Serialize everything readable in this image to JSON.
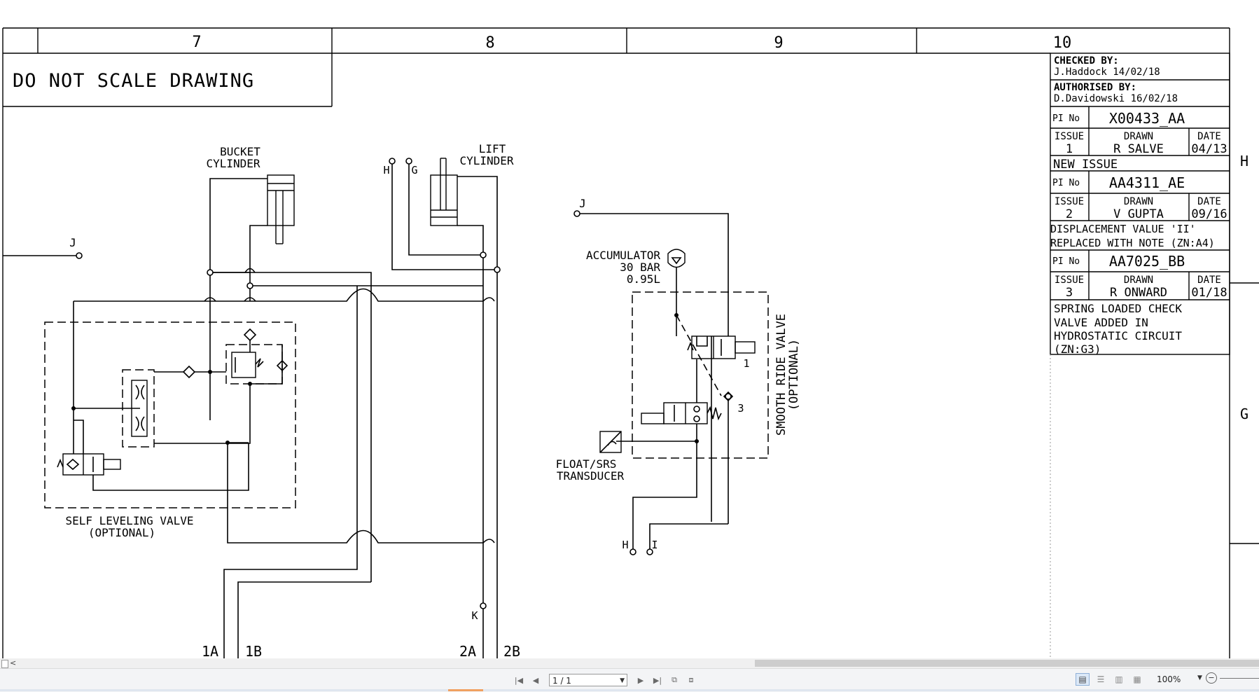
{
  "grid": {
    "columns": [
      "7",
      "8",
      "9",
      "10"
    ],
    "rows": [
      "H",
      "G"
    ]
  },
  "note": "DO NOT SCALE DRAWING",
  "title_block": {
    "checked_label": "CHECKED BY:",
    "checked_value": "J.Haddock 14/02/18",
    "authorised_label": "AUTHORISED BY:",
    "authorised_value": "D.Davidowski 16/02/18",
    "pi_label": "PI No",
    "issue_label": "ISSUE",
    "drawn_label": "DRAWN",
    "date_label": "DATE",
    "revisions": [
      {
        "pi": "X00433_AA",
        "issue": "1",
        "drawn": "R SALVE",
        "date": "04/13",
        "note": [
          "NEW ISSUE"
        ]
      },
      {
        "pi": "AA4311_AE",
        "issue": "2",
        "drawn": "V GUPTA",
        "date": "09/16",
        "note": [
          "DISPLACEMENT VALUE 'II'",
          "REPLACED WITH NOTE (ZN:A4)"
        ]
      },
      {
        "pi": "AA7025_BB",
        "issue": "3",
        "drawn": "R ONWARD",
        "date": "01/18",
        "note": [
          "SPRING LOADED CHECK",
          "VALVE ADDED IN",
          "HYDROSTATIC CIRCUIT",
          "(ZN:G3)"
        ]
      }
    ]
  },
  "labels": {
    "bucket_cylinder": [
      "BUCKET",
      "CYLINDER"
    ],
    "lift_cylinder": [
      "LIFT",
      "CYLINDER"
    ],
    "accumulator": [
      "ACCUMULATOR",
      "30 BAR",
      "0.95L"
    ],
    "self_leveling": [
      "SELF LEVELING VALVE",
      "(OPTIONAL)"
    ],
    "smooth_ride": [
      "SMOOTH RIDE VALVE",
      "(OPTIONAL)"
    ],
    "transducer": [
      "FLOAT/SRS",
      "TRANSDUCER"
    ]
  },
  "ports": {
    "j_left": "J",
    "h_top": "H",
    "g_top": "G",
    "j_right": "J",
    "h_bottom": "H",
    "i_bottom": "I",
    "k": "K",
    "p1a": "1A",
    "p1b": "1B",
    "p2a": "2A",
    "p2b": "2B",
    "sol1": "1",
    "sol3": "3"
  },
  "viewer": {
    "page_value": "1 / 1",
    "zoom": "100%"
  }
}
